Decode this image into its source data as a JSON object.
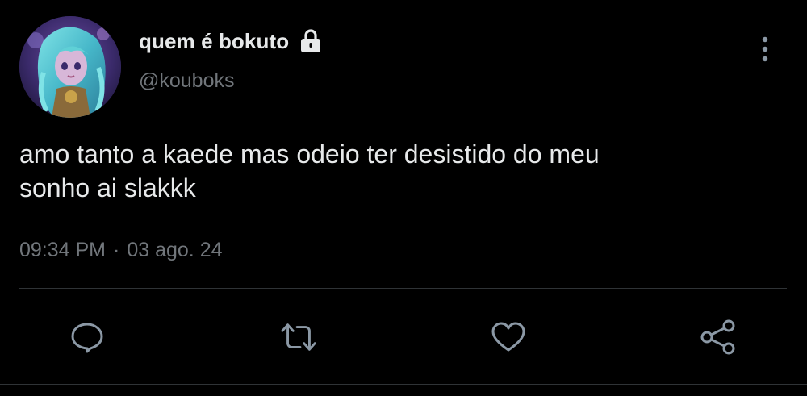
{
  "author": {
    "display_name": "quem é bokuto",
    "handle": "@kouboks",
    "avatar_icon": "avatar-image",
    "protected_icon": "lock-icon"
  },
  "tweet": {
    "text_line1": "amo tanto a kaede mas odeio ter desistido do meu",
    "text_line2": "sonho ai slakkk",
    "time": "09:34 PM",
    "separator": "·",
    "date": "03 ago. 24"
  },
  "actions": {
    "reply_icon": "reply-icon",
    "retweet_icon": "retweet-icon",
    "like_icon": "heart-icon",
    "share_icon": "share-icon",
    "more_icon": "more-vertical-icon"
  },
  "colors": {
    "background": "#000000",
    "text": "#e7e9ea",
    "secondary": "#71767b",
    "divider": "#2f3336",
    "icon": "#8b98a5"
  }
}
